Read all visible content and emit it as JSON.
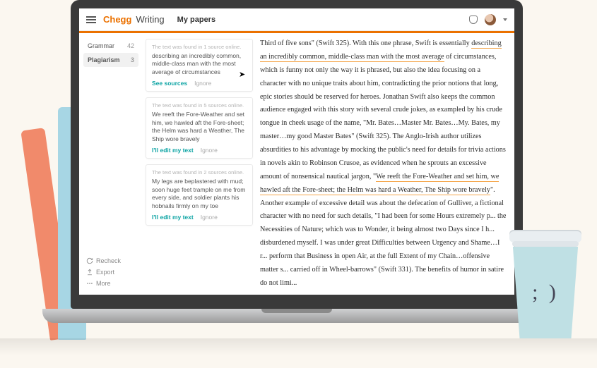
{
  "header": {
    "brand_chegg": "Chegg",
    "brand_writing": "Writing",
    "page_title": "My papers"
  },
  "sidebar": {
    "items": [
      {
        "label": "Grammar",
        "count": "42"
      },
      {
        "label": "Plagiarism",
        "count": "3"
      }
    ],
    "footer": {
      "recheck": "Recheck",
      "export": "Export",
      "more": "More"
    }
  },
  "cards": [
    {
      "meta": "The text was found in 1 source online.",
      "excerpt": "describing an incredibly common, middle-class man with the most average of circumstances",
      "primary": "See sources",
      "ignore": "Ignore"
    },
    {
      "meta": "The text was found in 5 sources online.",
      "excerpt": "We reeft the Fore-Weather and  set him, we hawled aft the Fore-sheet; the Helm was hard a Weather, The Ship wore bravely",
      "primary": "I'll edit my text",
      "ignore": "Ignore"
    },
    {
      "meta": "The text was found in 2 sources online.",
      "excerpt": "My legs are beplastered with mud; soon huge feet trample on me from every side, and soldier plants his hobnails firmly on my toe",
      "primary": "I'll edit my text",
      "ignore": "Ignore"
    }
  ],
  "document": {
    "p1a": "Third of five sons\" (Swift 325). With this one phrase, Swift is essentially ",
    "p1h1": "describing an incredibly common, middle-class man with the most average",
    "p1b": " of circumstances, which is funny not only the way it is phrased, but also the idea focusing on a character with no unique traits about him, contradicting the prior notions that long, epic stories should be reserved for heroes. Jonathan Swift also keeps the common audience engaged with this story with several crude jokes, as exampled by his crude tongue in cheek usage of the name, \"Mr. Bates…Master Mr. Bates…My. Bates, my master…my good Master Bates\" (Swift 325). The Anglo-Irish author utilizes absurdities to his advantage by mocking the public's need for details for trivia actions in novels akin to Robinson Crusoe, as evidenced when he sprouts an excessive amount of nonsensical nautical jargon, \"",
    "p1h2": "We reeft the Fore-Weather and  set him, we hawled aft the Fore-sheet; the Helm was hard a Weather, The Ship wore bravely",
    "p1c": "\". Another example of excessive detail was about the defecation of Gulliver, a fictional character with no need for such details, \"I had been for some Hours extremely p... the Necessities of Nature; which was to Wonder, it being almost two Days since I h... disburdened myself. I was under great Difficulties between Urgency and Shame…I r... perform that Business in open Air, at the full Extent of my Chain…offensive matter s... carried off in Wheel-barrows\" (Swift 331). The benefits of humor in satire do not limi..."
  },
  "cup_face": "; )"
}
